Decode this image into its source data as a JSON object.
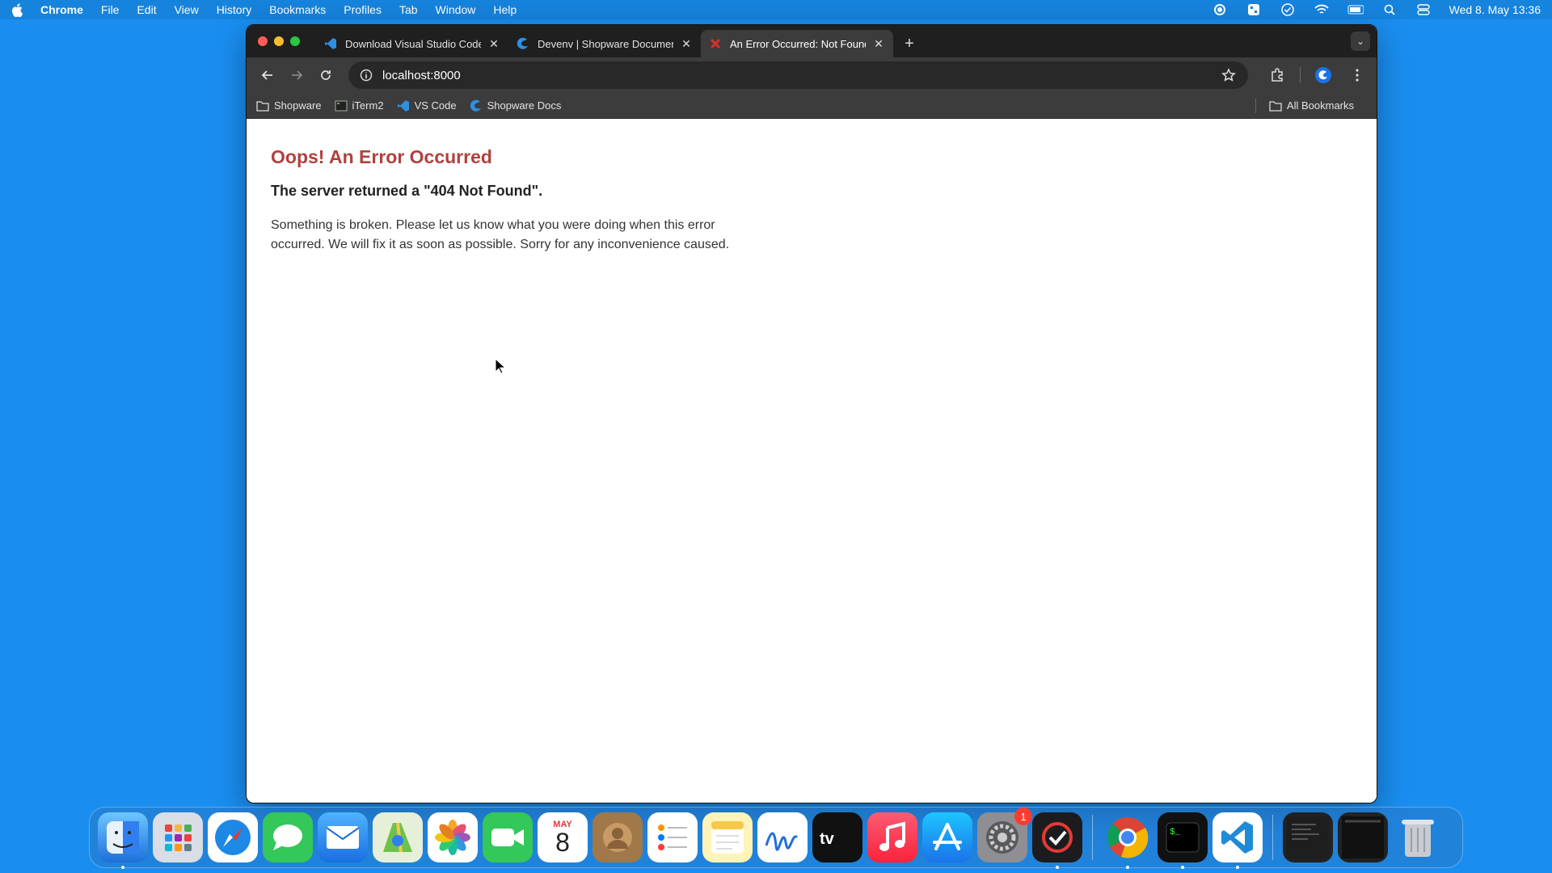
{
  "menubar": {
    "app": "Chrome",
    "items": [
      "File",
      "Edit",
      "View",
      "History",
      "Bookmarks",
      "Profiles",
      "Tab",
      "Window",
      "Help"
    ],
    "clock": "Wed 8. May  13:36"
  },
  "tabs": [
    {
      "title": "Download Visual Studio Code",
      "icon": "vscode-icon",
      "active": false
    },
    {
      "title": "Devenv | Shopware Documentation",
      "icon": "shopware-icon",
      "active": false
    },
    {
      "title": "An Error Occurred: Not Found",
      "icon": "error-x-icon",
      "active": true
    }
  ],
  "toolbar": {
    "url": "localhost:8000"
  },
  "bookmarks": {
    "items": [
      {
        "label": "Shopware",
        "icon": "folder-icon"
      },
      {
        "label": "iTerm2",
        "icon": "terminal-icon"
      },
      {
        "label": "VS Code",
        "icon": "vscode-icon"
      },
      {
        "label": "Shopware Docs",
        "icon": "shopware-icon"
      }
    ],
    "all_label": "All Bookmarks"
  },
  "page": {
    "heading": "Oops! An Error Occurred",
    "subheading": "The server returned a \"404 Not Found\".",
    "message": "Something is broken. Please let us know what you were doing when this error occurred. We will fix it as soon as possible. Sorry for any inconvenience caused."
  },
  "dock": {
    "calendar_month": "MAY",
    "calendar_day": "8",
    "settings_badge": "1"
  },
  "colors": {
    "desktop": "#1a8ef0",
    "error_heading": "#b0413e"
  }
}
